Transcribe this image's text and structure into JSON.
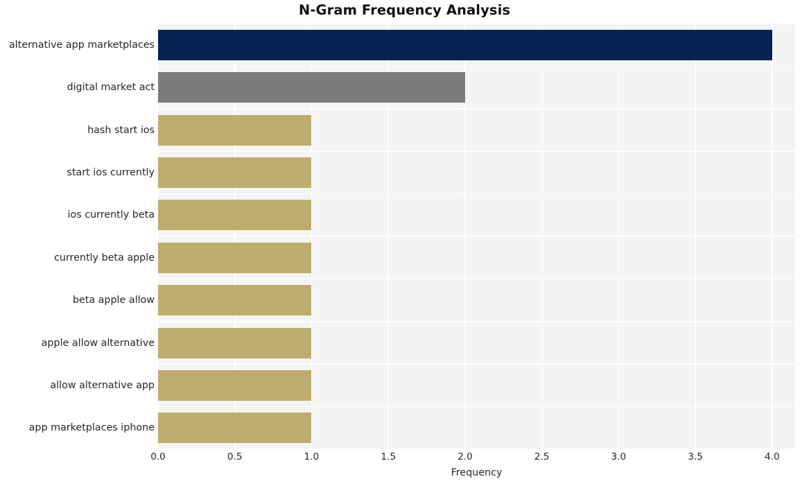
{
  "chart_data": {
    "type": "bar",
    "orientation": "horizontal",
    "title": "N-Gram Frequency Analysis",
    "xlabel": "Frequency",
    "ylabel": "",
    "categories": [
      "alternative app marketplaces",
      "digital market act",
      "hash start ios",
      "start ios currently",
      "ios currently beta",
      "currently beta apple",
      "beta apple allow",
      "apple allow alternative",
      "allow alternative app",
      "app marketplaces iphone"
    ],
    "values": [
      4,
      2,
      1,
      1,
      1,
      1,
      1,
      1,
      1,
      1
    ],
    "bar_colors": [
      "#042354",
      "#7c7c7a",
      "#bcac6e",
      "#bcac6e",
      "#bcac6e",
      "#bcac6e",
      "#bcac6e",
      "#bcac6e",
      "#bcac6e",
      "#bcac6e"
    ],
    "xlim": [
      0,
      4.15
    ],
    "xticks": [
      0,
      0.5,
      1,
      1.5,
      2,
      2.5,
      3,
      3.5,
      4
    ],
    "xtick_labels": [
      "0.0",
      "0.5",
      "1.0",
      "1.5",
      "2.0",
      "2.5",
      "3.0",
      "3.5",
      "4.0"
    ],
    "grid": true,
    "grid_color": "#ffffff",
    "plot_background": "#f4f4f4",
    "figure_background": "#ffffff",
    "legend": null,
    "style": "whitegrid"
  }
}
